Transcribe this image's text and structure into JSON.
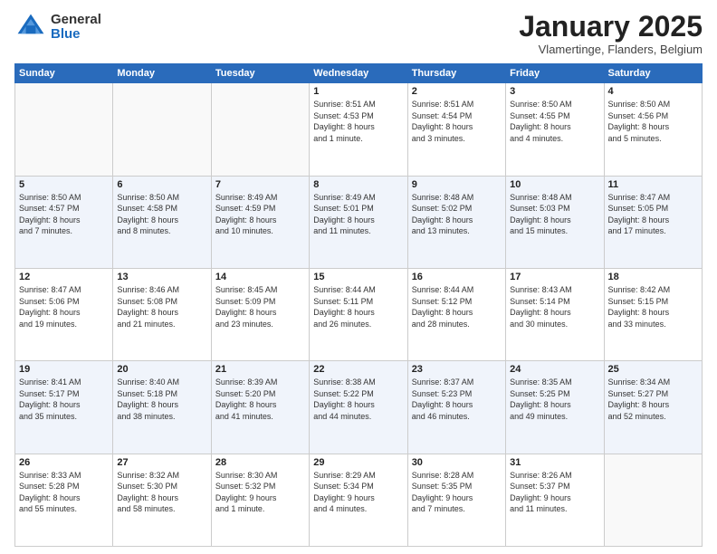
{
  "header": {
    "logo_general": "General",
    "logo_blue": "Blue",
    "month_title": "January 2025",
    "subtitle": "Vlamertinge, Flanders, Belgium"
  },
  "days_of_week": [
    "Sunday",
    "Monday",
    "Tuesday",
    "Wednesday",
    "Thursday",
    "Friday",
    "Saturday"
  ],
  "weeks": [
    [
      {
        "day": "",
        "info": ""
      },
      {
        "day": "",
        "info": ""
      },
      {
        "day": "",
        "info": ""
      },
      {
        "day": "1",
        "info": "Sunrise: 8:51 AM\nSunset: 4:53 PM\nDaylight: 8 hours\nand 1 minute."
      },
      {
        "day": "2",
        "info": "Sunrise: 8:51 AM\nSunset: 4:54 PM\nDaylight: 8 hours\nand 3 minutes."
      },
      {
        "day": "3",
        "info": "Sunrise: 8:50 AM\nSunset: 4:55 PM\nDaylight: 8 hours\nand 4 minutes."
      },
      {
        "day": "4",
        "info": "Sunrise: 8:50 AM\nSunset: 4:56 PM\nDaylight: 8 hours\nand 5 minutes."
      }
    ],
    [
      {
        "day": "5",
        "info": "Sunrise: 8:50 AM\nSunset: 4:57 PM\nDaylight: 8 hours\nand 7 minutes."
      },
      {
        "day": "6",
        "info": "Sunrise: 8:50 AM\nSunset: 4:58 PM\nDaylight: 8 hours\nand 8 minutes."
      },
      {
        "day": "7",
        "info": "Sunrise: 8:49 AM\nSunset: 4:59 PM\nDaylight: 8 hours\nand 10 minutes."
      },
      {
        "day": "8",
        "info": "Sunrise: 8:49 AM\nSunset: 5:01 PM\nDaylight: 8 hours\nand 11 minutes."
      },
      {
        "day": "9",
        "info": "Sunrise: 8:48 AM\nSunset: 5:02 PM\nDaylight: 8 hours\nand 13 minutes."
      },
      {
        "day": "10",
        "info": "Sunrise: 8:48 AM\nSunset: 5:03 PM\nDaylight: 8 hours\nand 15 minutes."
      },
      {
        "day": "11",
        "info": "Sunrise: 8:47 AM\nSunset: 5:05 PM\nDaylight: 8 hours\nand 17 minutes."
      }
    ],
    [
      {
        "day": "12",
        "info": "Sunrise: 8:47 AM\nSunset: 5:06 PM\nDaylight: 8 hours\nand 19 minutes."
      },
      {
        "day": "13",
        "info": "Sunrise: 8:46 AM\nSunset: 5:08 PM\nDaylight: 8 hours\nand 21 minutes."
      },
      {
        "day": "14",
        "info": "Sunrise: 8:45 AM\nSunset: 5:09 PM\nDaylight: 8 hours\nand 23 minutes."
      },
      {
        "day": "15",
        "info": "Sunrise: 8:44 AM\nSunset: 5:11 PM\nDaylight: 8 hours\nand 26 minutes."
      },
      {
        "day": "16",
        "info": "Sunrise: 8:44 AM\nSunset: 5:12 PM\nDaylight: 8 hours\nand 28 minutes."
      },
      {
        "day": "17",
        "info": "Sunrise: 8:43 AM\nSunset: 5:14 PM\nDaylight: 8 hours\nand 30 minutes."
      },
      {
        "day": "18",
        "info": "Sunrise: 8:42 AM\nSunset: 5:15 PM\nDaylight: 8 hours\nand 33 minutes."
      }
    ],
    [
      {
        "day": "19",
        "info": "Sunrise: 8:41 AM\nSunset: 5:17 PM\nDaylight: 8 hours\nand 35 minutes."
      },
      {
        "day": "20",
        "info": "Sunrise: 8:40 AM\nSunset: 5:18 PM\nDaylight: 8 hours\nand 38 minutes."
      },
      {
        "day": "21",
        "info": "Sunrise: 8:39 AM\nSunset: 5:20 PM\nDaylight: 8 hours\nand 41 minutes."
      },
      {
        "day": "22",
        "info": "Sunrise: 8:38 AM\nSunset: 5:22 PM\nDaylight: 8 hours\nand 44 minutes."
      },
      {
        "day": "23",
        "info": "Sunrise: 8:37 AM\nSunset: 5:23 PM\nDaylight: 8 hours\nand 46 minutes."
      },
      {
        "day": "24",
        "info": "Sunrise: 8:35 AM\nSunset: 5:25 PM\nDaylight: 8 hours\nand 49 minutes."
      },
      {
        "day": "25",
        "info": "Sunrise: 8:34 AM\nSunset: 5:27 PM\nDaylight: 8 hours\nand 52 minutes."
      }
    ],
    [
      {
        "day": "26",
        "info": "Sunrise: 8:33 AM\nSunset: 5:28 PM\nDaylight: 8 hours\nand 55 minutes."
      },
      {
        "day": "27",
        "info": "Sunrise: 8:32 AM\nSunset: 5:30 PM\nDaylight: 8 hours\nand 58 minutes."
      },
      {
        "day": "28",
        "info": "Sunrise: 8:30 AM\nSunset: 5:32 PM\nDaylight: 9 hours\nand 1 minute."
      },
      {
        "day": "29",
        "info": "Sunrise: 8:29 AM\nSunset: 5:34 PM\nDaylight: 9 hours\nand 4 minutes."
      },
      {
        "day": "30",
        "info": "Sunrise: 8:28 AM\nSunset: 5:35 PM\nDaylight: 9 hours\nand 7 minutes."
      },
      {
        "day": "31",
        "info": "Sunrise: 8:26 AM\nSunset: 5:37 PM\nDaylight: 9 hours\nand 11 minutes."
      },
      {
        "day": "",
        "info": ""
      }
    ]
  ]
}
